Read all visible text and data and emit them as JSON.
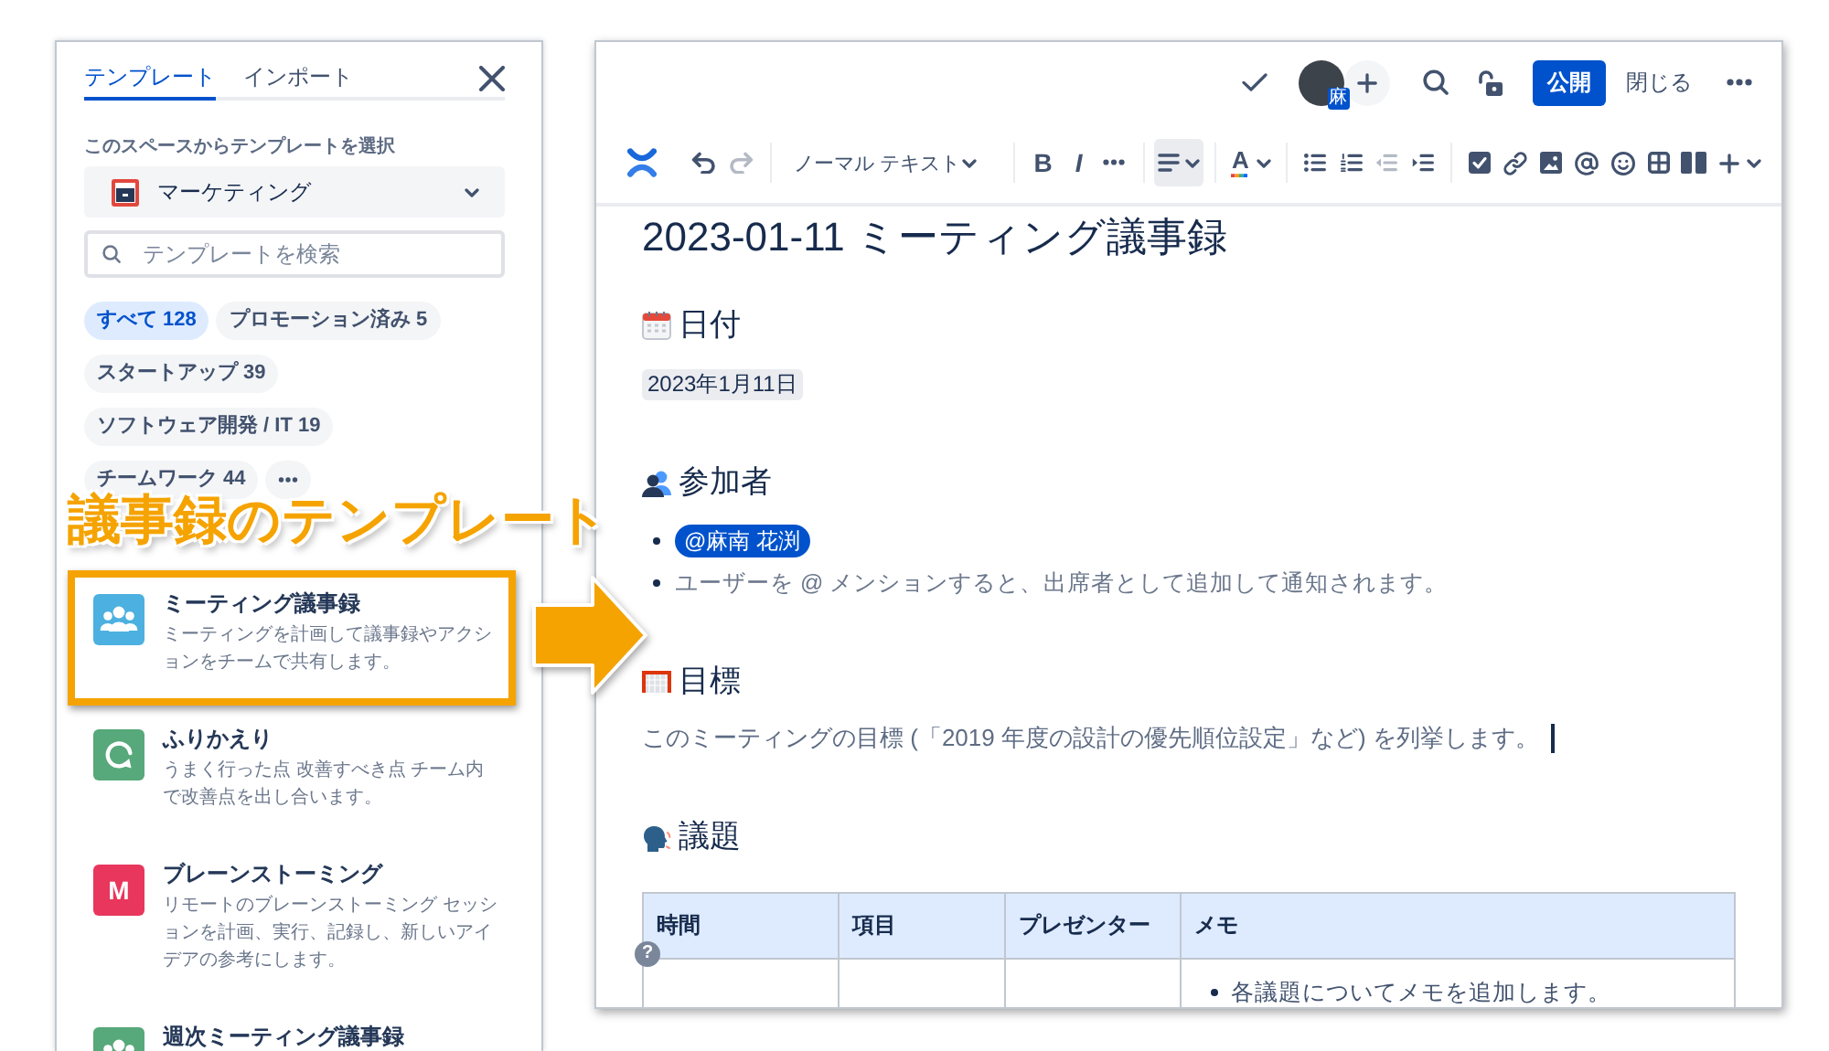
{
  "template_panel": {
    "tabs": [
      {
        "label": "テンプレート",
        "selected": true
      },
      {
        "label": "インポート",
        "selected": false
      }
    ],
    "space_label": "このスペースからテンプレートを選択",
    "space_select": {
      "value": "マーケティング"
    },
    "search": {
      "placeholder": "テンプレートを検索"
    },
    "filters": [
      {
        "label": "すべて",
        "count": "128",
        "selected": true
      },
      {
        "label": "プロモーション済み",
        "count": "5",
        "selected": false
      },
      {
        "label": "スタートアップ",
        "count": "39",
        "selected": false
      },
      {
        "label": "ソフトウェア開発 / IT",
        "count": "19",
        "selected": false
      },
      {
        "label": "チームワーク",
        "count": "44",
        "selected": false
      }
    ],
    "templates": [
      {
        "kind": "meeting-notes",
        "title": "ミーティング議事録",
        "description": "ミーティングを計画して議事録やアクションをチームで共有します。",
        "highlighted": true
      },
      {
        "kind": "retrospective",
        "title": "ふりかえり",
        "description": "うまく行った点 改善すべき点 チーム内で改善点を出し合います。",
        "highlighted": false
      },
      {
        "kind": "brainstorm",
        "icon_text": "M",
        "title": "ブレーンストーミング",
        "description": "リモートのブレーンストーミング セッションを計画、実行、記録し、新しいアイデアの参考にします。",
        "highlighted": false
      },
      {
        "kind": "weekly-meeting",
        "title": "週次ミーティング議事録",
        "highlighted": false
      }
    ]
  },
  "annotation": {
    "caption": "議事録のテンプレート"
  },
  "editor": {
    "top_bar": {
      "avatar_badge": "麻",
      "publish_button": "公開",
      "close_button": "閉じる"
    },
    "toolbar": {
      "undo": {
        "disabled": false
      },
      "redo": {
        "disabled": true
      },
      "text_style": "ノーマル テキスト",
      "bold": "B",
      "italic": "I",
      "alignment": {
        "active": true
      },
      "text_color": "A",
      "outdent": {
        "disabled": true
      },
      "indent": {
        "disabled": false
      }
    },
    "page": {
      "title": "2023-01-11 ミーティング議事録",
      "sections": [
        {
          "kind": "date",
          "heading": "日付",
          "date": "2023年1月11日"
        },
        {
          "kind": "participants",
          "heading": "参加者",
          "items": [
            {
              "kind": "mention",
              "text": "@麻南 花渕"
            },
            {
              "kind": "hint",
              "text": "ユーザーを @ メンションすると、出席者として追加して通知されます。"
            }
          ]
        },
        {
          "kind": "goals",
          "heading": "目標",
          "text": "このミーティングの目標 (「2019 年度の設計の優先順位設定」など) を列挙します。",
          "cursor": true
        },
        {
          "kind": "agenda",
          "heading": "議題",
          "table": {
            "columns": [
              "時間",
              "項目",
              "プレゼンター",
              "メモ"
            ],
            "rows": [
              {
                "notes": [
                  "各議題についてメモを追加します。"
                ]
              }
            ]
          }
        }
      ]
    },
    "help_button": "?"
  }
}
